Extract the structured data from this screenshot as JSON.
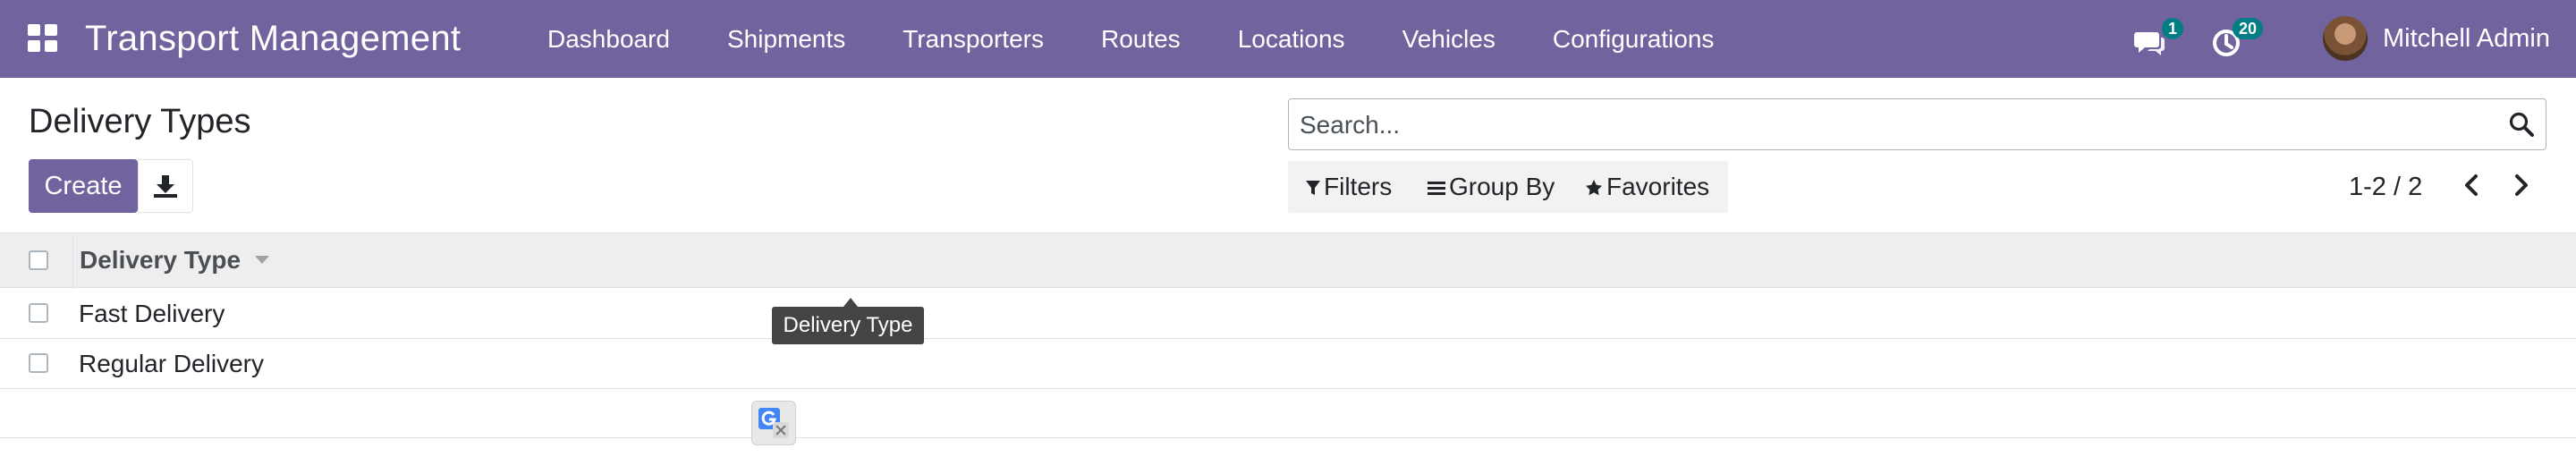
{
  "navbar": {
    "app_title": "Transport Management",
    "menu": [
      "Dashboard",
      "Shipments",
      "Transporters",
      "Routes",
      "Locations",
      "Vehicles",
      "Configurations"
    ],
    "messages_count": "1",
    "activities_count": "20",
    "user_name": "Mitchell Admin"
  },
  "control_panel": {
    "title": "Delivery Types",
    "create_label": "Create",
    "search_placeholder": "Search...",
    "filters_label": "Filters",
    "group_by_label": "Group By",
    "favorites_label": "Favorites",
    "pager": "1-2 / 2"
  },
  "list": {
    "column_header": "Delivery Type",
    "rows": [
      "Fast Delivery",
      "Regular Delivery"
    ]
  },
  "tooltip": "Delivery Type",
  "colors": {
    "brand": "#71639e",
    "badge": "#017e84",
    "header_bg": "#eeeeee"
  },
  "icons": [
    "apps-grid-icon",
    "chat-icon",
    "clock-icon",
    "download-icon",
    "search-icon",
    "filter-icon",
    "list-icon",
    "star-icon",
    "chevron-left-icon",
    "chevron-right-icon",
    "translate-icon"
  ]
}
